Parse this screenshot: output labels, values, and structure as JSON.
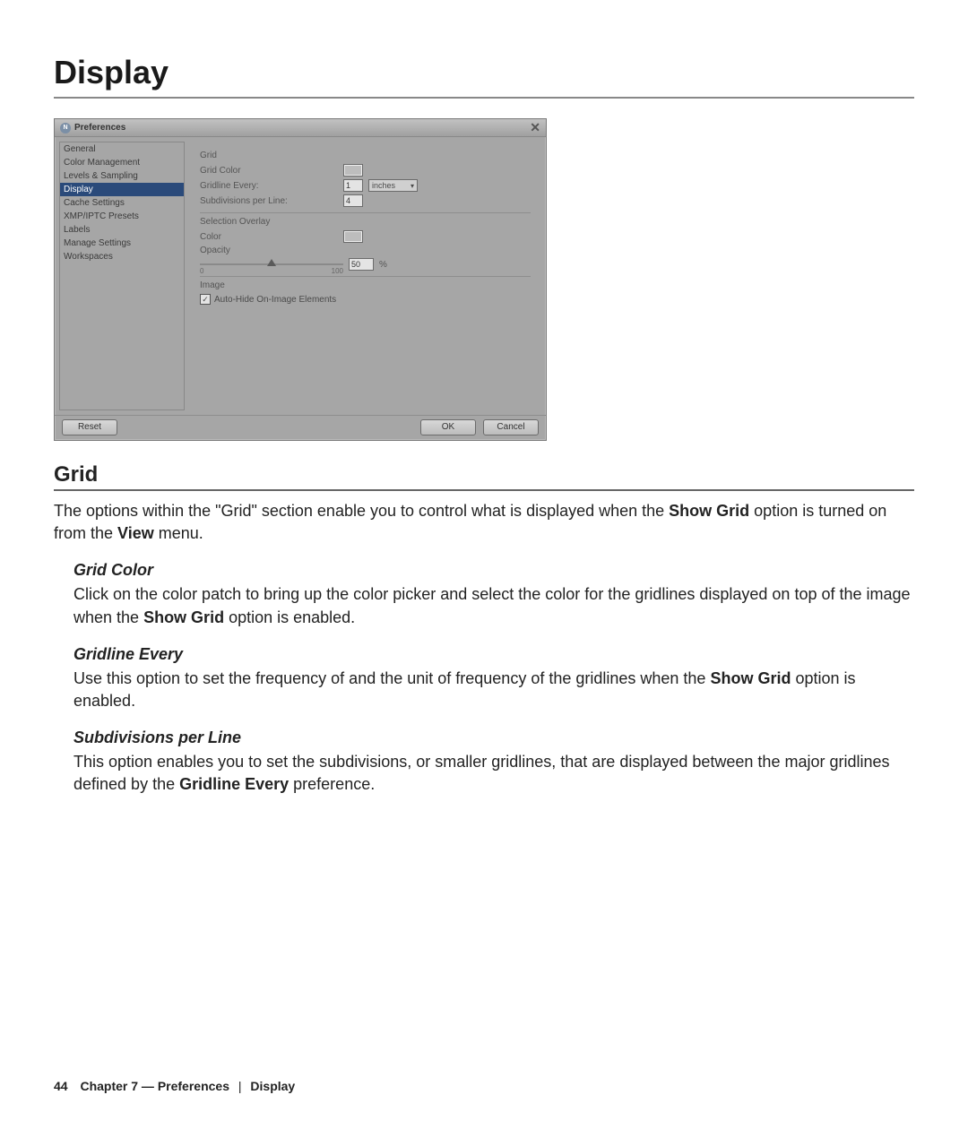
{
  "page": {
    "title": "Display",
    "number": "44",
    "footer_chapter": "Chapter 7 — Preferences",
    "footer_section": "Display"
  },
  "dialog": {
    "title": "Preferences",
    "sidebar": [
      {
        "label": "General",
        "selected": false
      },
      {
        "label": "Color Management",
        "selected": false
      },
      {
        "label": "Levels & Sampling",
        "selected": false
      },
      {
        "label": "Display",
        "selected": true
      },
      {
        "label": "Cache Settings",
        "selected": false
      },
      {
        "label": "XMP/IPTC Presets",
        "selected": false
      },
      {
        "label": "Labels",
        "selected": false
      },
      {
        "label": "Manage Settings",
        "selected": false
      },
      {
        "label": "Workspaces",
        "selected": false
      }
    ],
    "grid": {
      "section_title": "Grid",
      "color_label": "Grid Color",
      "gridline_every_label": "Gridline Every:",
      "gridline_every_value": "1",
      "gridline_every_unit": "inches",
      "subdivisions_label": "Subdivisions per Line:",
      "subdivisions_value": "4"
    },
    "overlay": {
      "section_title": "Selection Overlay",
      "color_label": "Color",
      "opacity_label": "Opacity",
      "slider_min": "0",
      "slider_max": "100",
      "opacity_value": "50",
      "percent": "%"
    },
    "image": {
      "section_title": "Image",
      "autohide_label": "Auto-Hide On-Image Elements",
      "autohide_checked": true
    },
    "buttons": {
      "reset": "Reset",
      "ok": "OK",
      "cancel": "Cancel"
    }
  },
  "doc": {
    "h2_grid": "Grid",
    "p_grid_1a": "The options within the \"Grid\" section enable you to control what is displayed when the ",
    "p_grid_1b": "Show Grid",
    "p_grid_1c": " option is turned on from the ",
    "p_grid_1d": "View",
    "p_grid_1e": " menu.",
    "h3_gridcolor": "Grid Color",
    "p_gridcolor_a": "Click on the color patch to bring up the color picker and select the color for the gridlines displayed on top of the image when the ",
    "p_gridcolor_b": "Show Grid",
    "p_gridcolor_c": " option is enabled.",
    "h3_gridline": "Gridline Every",
    "p_gridline_a": "Use this option to set the frequency of and the unit of frequency of the gridlines when the ",
    "p_gridline_b": "Show Grid",
    "p_gridline_c": " option is enabled.",
    "h3_subdiv": "Subdivisions per Line",
    "p_subdiv_a": "This option enables you to set the subdivisions, or smaller gridlines, that are displayed between the major gridlines defined by the ",
    "p_subdiv_b": "Gridline Every",
    "p_subdiv_c": " preference."
  }
}
